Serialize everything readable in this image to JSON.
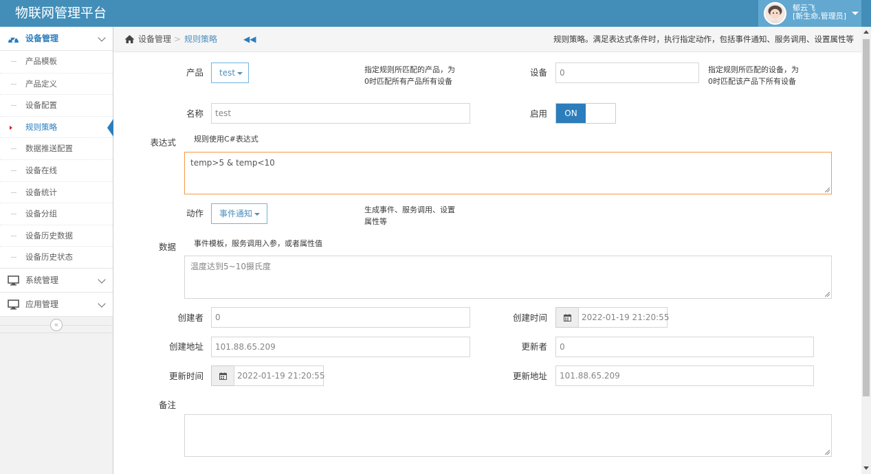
{
  "app": {
    "title": "物联网管理平台"
  },
  "user": {
    "name": "郁云飞",
    "role": "[新生命,管理员]"
  },
  "sidebar": {
    "groups": [
      {
        "label": "设备管理",
        "icon": "dashboard-icon",
        "expanded": true
      },
      {
        "label": "系统管理",
        "icon": "desktop-icon",
        "expanded": false
      },
      {
        "label": "应用管理",
        "icon": "desktop-icon",
        "expanded": false
      }
    ],
    "items": [
      "产品模板",
      "产品定义",
      "设备配置",
      "规则策略",
      "数据推送配置",
      "设备在线",
      "设备统计",
      "设备分组",
      "设备历史数据",
      "设备历史状态"
    ],
    "active_item": "规则策略",
    "collapse_glyph": "«"
  },
  "breadcrumb": {
    "home": "设备管理",
    "separator": ">",
    "current": "规则策略",
    "back_glyph": "◀◀",
    "description": "规则策略。满足表达式条件时，执行指定动作，包括事件通知、服务调用、设置属性等"
  },
  "form": {
    "product": {
      "label": "产品",
      "value": "test",
      "hint_line1": "指定规则所匹配的产品，为",
      "hint_line2": "0时匹配所有产品所有设备"
    },
    "device": {
      "label": "设备",
      "value": "0",
      "hint_line1": "指定规则所匹配的设备，为",
      "hint_line2": "0时匹配该产品下所有设备"
    },
    "name": {
      "label": "名称",
      "value": "test"
    },
    "enable": {
      "label": "启用",
      "value": "ON"
    },
    "expression": {
      "label": "表达式",
      "hint": "规则使用C#表达式",
      "value": "temp>5 & temp<10"
    },
    "action": {
      "label": "动作",
      "value": "事件通知",
      "hint_line1": "生成事件、服务调用、设置",
      "hint_line2": "属性等"
    },
    "data": {
      "label": "数据",
      "hint": "事件模板，服务调用入参，或者属性值",
      "value": "温度达到5~10摄氏度"
    },
    "creator": {
      "label": "创建者",
      "value": "0"
    },
    "create_time": {
      "label": "创建时间",
      "value": "2022-01-19 21:20:55"
    },
    "create_ip": {
      "label": "创建地址",
      "value": "101.88.65.209"
    },
    "updater": {
      "label": "更新者",
      "value": "0"
    },
    "update_time": {
      "label": "更新时间",
      "value": "2022-01-19 21:20:55"
    },
    "update_ip": {
      "label": "更新地址",
      "value": "101.88.65.209"
    },
    "remark": {
      "label": "备注",
      "value": ""
    }
  },
  "colors": {
    "header": "#438eb9",
    "user_box": "#62a8d1",
    "accent": "#2b7dbc",
    "focus": "#f59942"
  }
}
